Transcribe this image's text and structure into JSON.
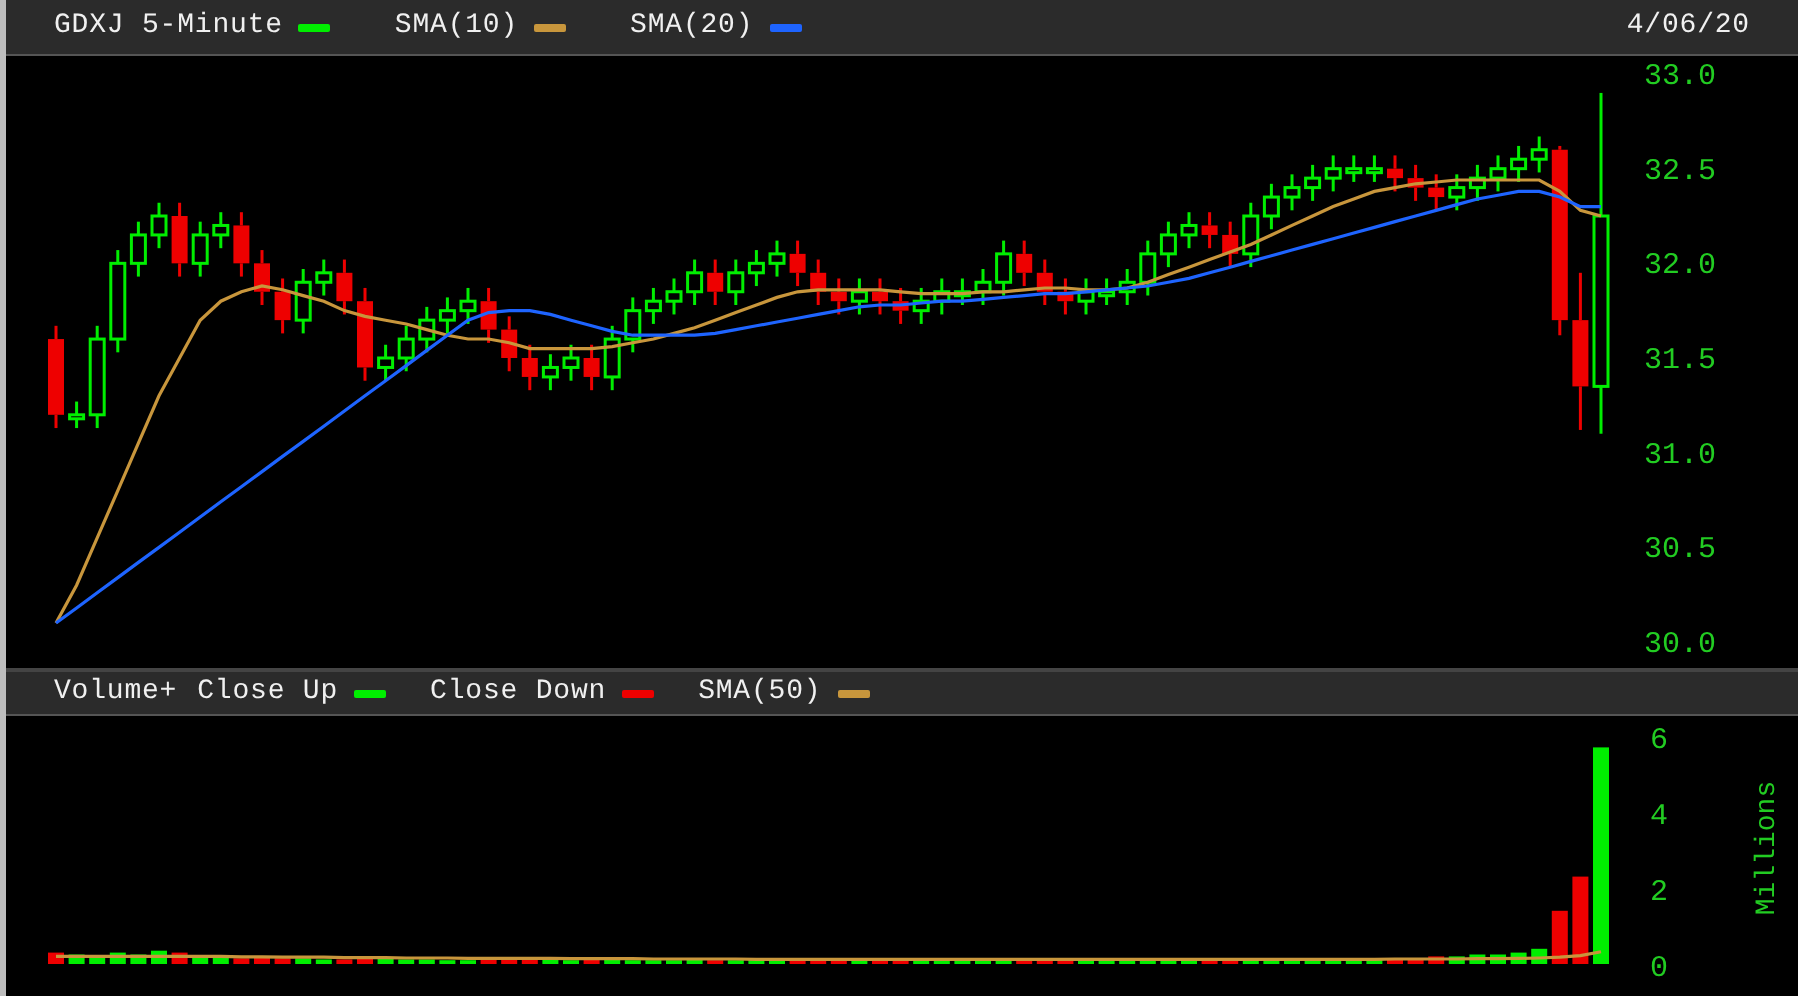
{
  "price_panel": {
    "ticker": {
      "text": "GDXJ 5-Minute",
      "color": "#00ee00"
    },
    "date": "4/06/20",
    "chart_data": {
      "type": "candlestick",
      "ylim": [
        30,
        33
      ],
      "yticks": [
        {
          "value": 30,
          "label": "30.0"
        },
        {
          "value": 30.5,
          "label": "30.5"
        },
        {
          "value": 31,
          "label": "31.0"
        },
        {
          "value": 31.5,
          "label": "31.5"
        },
        {
          "value": 32,
          "label": "32.0"
        },
        {
          "value": 32.5,
          "label": "32.5"
        },
        {
          "value": 33,
          "label": "33.0"
        }
      ],
      "ohlc": [
        [
          31.6,
          31.67,
          31.13,
          31.2
        ],
        [
          31.2,
          31.27,
          31.13,
          31.2
        ],
        [
          31.2,
          31.67,
          31.13,
          31.6
        ],
        [
          31.6,
          32.07,
          31.53,
          32.0
        ],
        [
          32.0,
          32.22,
          31.93,
          32.15
        ],
        [
          32.15,
          32.32,
          32.08,
          32.25
        ],
        [
          32.25,
          32.32,
          31.93,
          32.0
        ],
        [
          32.0,
          32.22,
          31.93,
          32.15
        ],
        [
          32.15,
          32.27,
          32.08,
          32.2
        ],
        [
          32.2,
          32.27,
          31.93,
          32.0
        ],
        [
          32.0,
          32.07,
          31.78,
          31.85
        ],
        [
          31.85,
          31.92,
          31.63,
          31.7
        ],
        [
          31.7,
          31.97,
          31.63,
          31.9
        ],
        [
          31.9,
          32.02,
          31.83,
          31.95
        ],
        [
          31.95,
          32.02,
          31.73,
          31.8
        ],
        [
          31.8,
          31.87,
          31.38,
          31.45
        ],
        [
          31.45,
          31.57,
          31.38,
          31.5
        ],
        [
          31.5,
          31.67,
          31.43,
          31.6
        ],
        [
          31.6,
          31.77,
          31.53,
          31.7
        ],
        [
          31.7,
          31.82,
          31.63,
          31.75
        ],
        [
          31.75,
          31.87,
          31.68,
          31.8
        ],
        [
          31.8,
          31.87,
          31.58,
          31.65
        ],
        [
          31.65,
          31.72,
          31.43,
          31.5
        ],
        [
          31.5,
          31.57,
          31.33,
          31.4
        ],
        [
          31.4,
          31.52,
          31.33,
          31.45
        ],
        [
          31.45,
          31.57,
          31.38,
          31.5
        ],
        [
          31.5,
          31.57,
          31.33,
          31.4
        ],
        [
          31.4,
          31.67,
          31.33,
          31.6
        ],
        [
          31.6,
          31.82,
          31.53,
          31.75
        ],
        [
          31.75,
          31.87,
          31.68,
          31.8
        ],
        [
          31.8,
          31.92,
          31.73,
          31.85
        ],
        [
          31.85,
          32.02,
          31.78,
          31.95
        ],
        [
          31.95,
          32.02,
          31.78,
          31.85
        ],
        [
          31.85,
          32.02,
          31.78,
          31.95
        ],
        [
          31.95,
          32.07,
          31.88,
          32.0
        ],
        [
          32.0,
          32.12,
          31.93,
          32.05
        ],
        [
          32.05,
          32.12,
          31.88,
          31.95
        ],
        [
          31.95,
          32.02,
          31.78,
          31.85
        ],
        [
          31.85,
          31.92,
          31.73,
          31.8
        ],
        [
          31.8,
          31.92,
          31.73,
          31.85
        ],
        [
          31.85,
          31.92,
          31.73,
          31.8
        ],
        [
          31.8,
          31.87,
          31.68,
          31.75
        ],
        [
          31.75,
          31.87,
          31.68,
          31.8
        ],
        [
          31.8,
          31.92,
          31.73,
          31.85
        ],
        [
          31.85,
          31.92,
          31.78,
          31.85
        ],
        [
          31.85,
          31.97,
          31.78,
          31.9
        ],
        [
          31.9,
          32.12,
          31.83,
          32.05
        ],
        [
          32.05,
          32.12,
          31.88,
          31.95
        ],
        [
          31.95,
          32.02,
          31.78,
          31.85
        ],
        [
          31.85,
          31.92,
          31.73,
          31.8
        ],
        [
          31.8,
          31.92,
          31.73,
          31.85
        ],
        [
          31.85,
          31.92,
          31.78,
          31.85
        ],
        [
          31.85,
          31.97,
          31.78,
          31.9
        ],
        [
          31.9,
          32.12,
          31.83,
          32.05
        ],
        [
          32.05,
          32.22,
          31.98,
          32.15
        ],
        [
          32.15,
          32.27,
          32.08,
          32.2
        ],
        [
          32.2,
          32.27,
          32.08,
          32.15
        ],
        [
          32.15,
          32.22,
          31.98,
          32.05
        ],
        [
          32.05,
          32.32,
          31.98,
          32.25
        ],
        [
          32.25,
          32.42,
          32.18,
          32.35
        ],
        [
          32.35,
          32.47,
          32.28,
          32.4
        ],
        [
          32.4,
          32.52,
          32.33,
          32.45
        ],
        [
          32.45,
          32.57,
          32.38,
          32.5
        ],
        [
          32.5,
          32.57,
          32.43,
          32.5
        ],
        [
          32.5,
          32.57,
          32.43,
          32.5
        ],
        [
          32.5,
          32.57,
          32.38,
          32.45
        ],
        [
          32.45,
          32.52,
          32.33,
          32.4
        ],
        [
          32.4,
          32.47,
          32.28,
          32.35
        ],
        [
          32.35,
          32.47,
          32.28,
          32.4
        ],
        [
          32.4,
          32.52,
          32.33,
          32.45
        ],
        [
          32.45,
          32.57,
          32.38,
          32.5
        ],
        [
          32.5,
          32.62,
          32.43,
          32.55
        ],
        [
          32.55,
          32.67,
          32.48,
          32.6
        ],
        [
          32.6,
          32.62,
          31.62,
          31.7
        ],
        [
          31.7,
          31.95,
          31.12,
          31.35
        ],
        [
          31.35,
          32.9,
          31.1,
          32.25
        ]
      ],
      "series": [
        {
          "name": "SMA(10)",
          "type": "line",
          "color": "#c8963c",
          "values": [
            30.1,
            30.3,
            30.55,
            30.8,
            31.05,
            31.3,
            31.5,
            31.7,
            31.8,
            31.85,
            31.88,
            31.86,
            31.83,
            31.8,
            31.75,
            31.72,
            31.7,
            31.68,
            31.65,
            31.62,
            31.6,
            31.6,
            31.58,
            31.55,
            31.55,
            31.55,
            31.55,
            31.56,
            31.58,
            31.6,
            31.63,
            31.66,
            31.7,
            31.74,
            31.78,
            31.82,
            31.85,
            31.86,
            31.86,
            31.86,
            31.86,
            31.85,
            31.84,
            31.84,
            31.84,
            31.85,
            31.85,
            31.86,
            31.87,
            31.87,
            31.86,
            31.86,
            31.87,
            31.9,
            31.94,
            31.98,
            32.02,
            32.06,
            32.1,
            32.15,
            32.2,
            32.25,
            32.3,
            32.34,
            32.38,
            32.4,
            32.42,
            32.43,
            32.44,
            32.44,
            32.44,
            32.44,
            32.44,
            32.38,
            32.28,
            32.25
          ]
        },
        {
          "name": "SMA(20)",
          "type": "line",
          "color": "#1e64ff",
          "values": [
            30.1,
            30.18,
            30.26,
            30.34,
            30.42,
            30.5,
            30.58,
            30.66,
            30.74,
            30.82,
            30.9,
            30.98,
            31.06,
            31.14,
            31.22,
            31.3,
            31.38,
            31.46,
            31.54,
            31.62,
            31.7,
            31.74,
            31.75,
            31.75,
            31.73,
            31.7,
            31.67,
            31.64,
            31.62,
            31.62,
            31.62,
            31.62,
            31.63,
            31.65,
            31.67,
            31.69,
            31.71,
            31.73,
            31.75,
            31.77,
            31.78,
            31.78,
            31.79,
            31.8,
            31.8,
            31.81,
            31.82,
            31.83,
            31.84,
            31.84,
            31.85,
            31.86,
            31.87,
            31.88,
            31.9,
            31.92,
            31.95,
            31.98,
            32.01,
            32.04,
            32.07,
            32.1,
            32.13,
            32.16,
            32.19,
            32.22,
            32.25,
            32.28,
            32.31,
            32.34,
            32.36,
            32.38,
            32.38,
            32.35,
            32.3,
            32.3
          ]
        }
      ]
    }
  },
  "volume_panel": {
    "legend": [
      {
        "label": "Close Up",
        "color": "#00ee00"
      },
      {
        "label": "Close Down",
        "color": "#ee0000"
      }
    ],
    "chart_data": {
      "type": "bar",
      "ylabel": "Millions",
      "ylim": [
        0,
        6
      ],
      "yticks": [
        0,
        2,
        4,
        6
      ],
      "series": [
        {
          "name": "Volume+",
          "type": "bar",
          "colors": [
            "#ee0000",
            "#00ee00",
            "#00ee00",
            "#00ee00",
            "#00ee00",
            "#00ee00",
            "#ee0000",
            "#00ee00",
            "#00ee00",
            "#ee0000",
            "#ee0000",
            "#ee0000",
            "#00ee00",
            "#00ee00",
            "#ee0000",
            "#ee0000",
            "#00ee00",
            "#00ee00",
            "#00ee00",
            "#00ee00",
            "#00ee00",
            "#ee0000",
            "#ee0000",
            "#ee0000",
            "#00ee00",
            "#00ee00",
            "#ee0000",
            "#00ee00",
            "#00ee00",
            "#00ee00",
            "#00ee00",
            "#00ee00",
            "#ee0000",
            "#00ee00",
            "#00ee00",
            "#00ee00",
            "#ee0000",
            "#ee0000",
            "#ee0000",
            "#00ee00",
            "#ee0000",
            "#ee0000",
            "#00ee00",
            "#00ee00",
            "#00ee00",
            "#00ee00",
            "#00ee00",
            "#ee0000",
            "#ee0000",
            "#ee0000",
            "#00ee00",
            "#00ee00",
            "#00ee00",
            "#00ee00",
            "#00ee00",
            "#00ee00",
            "#ee0000",
            "#ee0000",
            "#00ee00",
            "#00ee00",
            "#00ee00",
            "#00ee00",
            "#00ee00",
            "#00ee00",
            "#00ee00",
            "#ee0000",
            "#ee0000",
            "#ee0000",
            "#00ee00",
            "#00ee00",
            "#00ee00",
            "#00ee00",
            "#00ee00",
            "#ee0000",
            "#ee0000",
            "#00ee00"
          ],
          "values": [
            0.3,
            0.25,
            0.2,
            0.3,
            0.25,
            0.35,
            0.3,
            0.2,
            0.2,
            0.15,
            0.2,
            0.15,
            0.15,
            0.12,
            0.12,
            0.2,
            0.15,
            0.12,
            0.12,
            0.1,
            0.1,
            0.12,
            0.12,
            0.15,
            0.12,
            0.1,
            0.12,
            0.12,
            0.1,
            0.1,
            0.1,
            0.12,
            0.1,
            0.1,
            0.1,
            0.1,
            0.12,
            0.1,
            0.1,
            0.1,
            0.1,
            0.1,
            0.1,
            0.1,
            0.1,
            0.1,
            0.12,
            0.1,
            0.1,
            0.1,
            0.1,
            0.1,
            0.1,
            0.12,
            0.1,
            0.1,
            0.1,
            0.1,
            0.12,
            0.12,
            0.12,
            0.12,
            0.15,
            0.12,
            0.12,
            0.15,
            0.15,
            0.2,
            0.2,
            0.25,
            0.25,
            0.3,
            0.4,
            1.4,
            2.3,
            5.7
          ]
        },
        {
          "name": "SMA(50)",
          "type": "line",
          "color": "#c8963c",
          "values": [
            0.2,
            0.2,
            0.2,
            0.2,
            0.2,
            0.2,
            0.2,
            0.2,
            0.2,
            0.19,
            0.19,
            0.18,
            0.18,
            0.18,
            0.17,
            0.17,
            0.17,
            0.16,
            0.16,
            0.16,
            0.15,
            0.15,
            0.15,
            0.15,
            0.15,
            0.14,
            0.14,
            0.14,
            0.14,
            0.13,
            0.13,
            0.13,
            0.13,
            0.13,
            0.12,
            0.12,
            0.12,
            0.12,
            0.12,
            0.12,
            0.12,
            0.12,
            0.12,
            0.12,
            0.12,
            0.12,
            0.12,
            0.12,
            0.12,
            0.12,
            0.12,
            0.12,
            0.12,
            0.12,
            0.12,
            0.12,
            0.12,
            0.12,
            0.12,
            0.12,
            0.12,
            0.12,
            0.12,
            0.12,
            0.12,
            0.13,
            0.13,
            0.13,
            0.13,
            0.14,
            0.14,
            0.15,
            0.16,
            0.18,
            0.22,
            0.32
          ]
        }
      ]
    }
  }
}
